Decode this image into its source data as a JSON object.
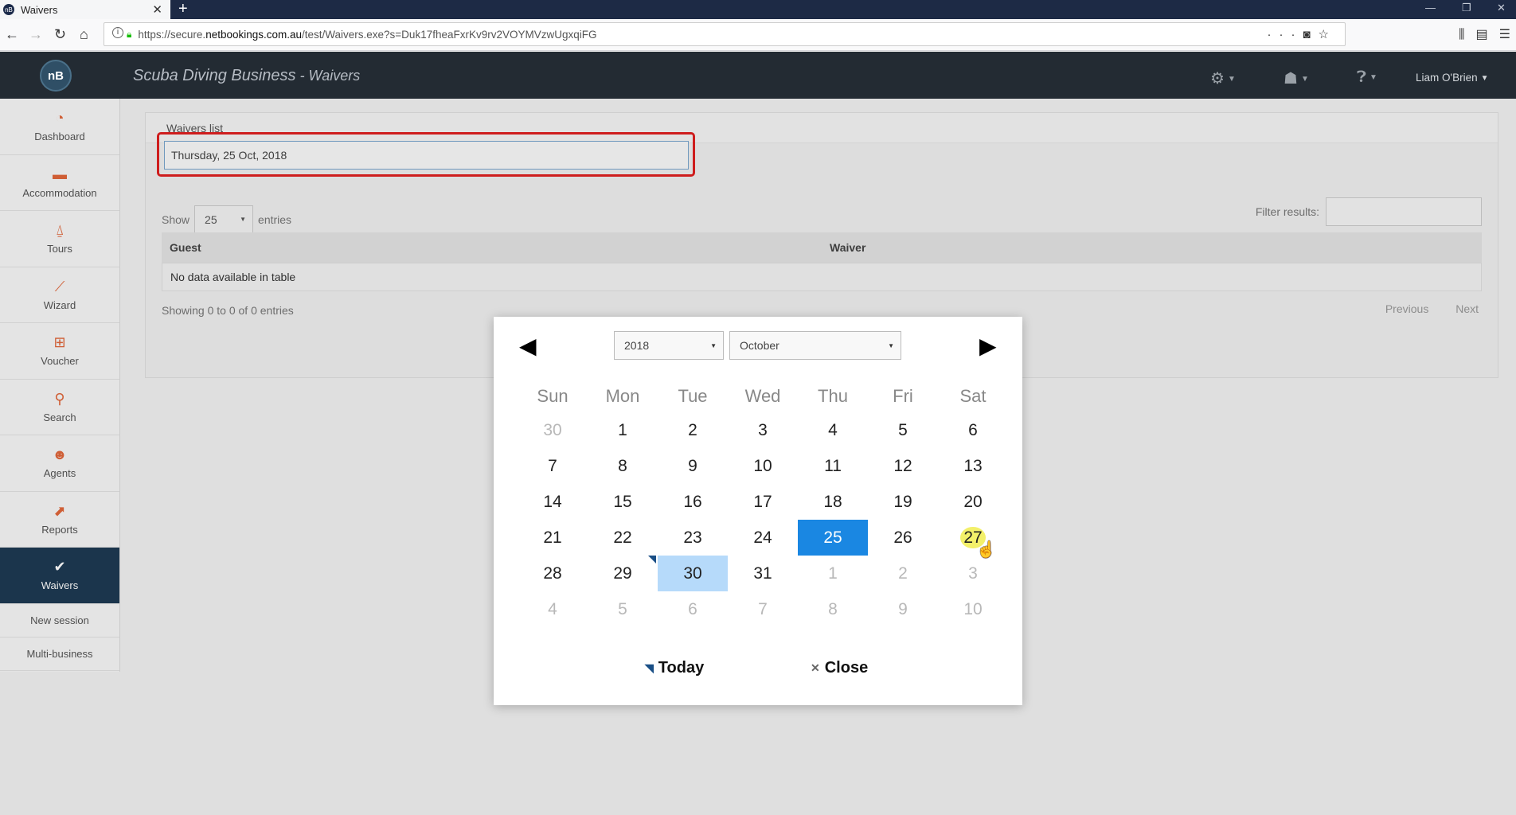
{
  "browser": {
    "tab_title": "Waivers",
    "favicon_text": "nB",
    "url_prefix": "https://secure.",
    "url_domain": "netbookings.com.au",
    "url_rest": "/test/Waivers.exe?s=Duk17fheaFxrKv9rv2VOYMVzwUgxqiFG"
  },
  "header": {
    "logo_text": "nB",
    "title": "Scuba Diving Business",
    "subtitle": " - Waivers",
    "user_name": "Liam O'Brien"
  },
  "sidebar": {
    "items": [
      {
        "label": "Dashboard",
        "icon": "dashboard-icon"
      },
      {
        "label": "Accommodation",
        "icon": "bed-icon"
      },
      {
        "label": "Tours",
        "icon": "hanger-icon"
      },
      {
        "label": "Wizard",
        "icon": "wand-icon"
      },
      {
        "label": "Voucher",
        "icon": "gift-icon"
      },
      {
        "label": "Search",
        "icon": "search-icon"
      },
      {
        "label": "Agents",
        "icon": "agent-icon"
      },
      {
        "label": "Reports",
        "icon": "chart-icon"
      },
      {
        "label": "Waivers",
        "icon": "check-icon"
      }
    ],
    "links": [
      "New session",
      "Multi-business"
    ]
  },
  "panel": {
    "title": "Waivers list",
    "date_value": "Thursday, 25 Oct, 2018",
    "show_label": "Show",
    "entries_value": "25",
    "entries_label": "entries",
    "filter_label": "Filter results:",
    "columns": [
      "Guest",
      "Waiver"
    ],
    "empty_text": "No data available in table",
    "showing_text": "Showing 0 to 0 of 0 entries",
    "prev_label": "Previous",
    "next_label": "Next"
  },
  "datepicker": {
    "year": "2018",
    "month": "October",
    "weekdays": [
      "Sun",
      "Mon",
      "Tue",
      "Wed",
      "Thu",
      "Fri",
      "Sat"
    ],
    "weeks": [
      [
        "30",
        "1",
        "2",
        "3",
        "4",
        "5",
        "6"
      ],
      [
        "7",
        "8",
        "9",
        "10",
        "11",
        "12",
        "13"
      ],
      [
        "14",
        "15",
        "16",
        "17",
        "18",
        "19",
        "20"
      ],
      [
        "21",
        "22",
        "23",
        "24",
        "25",
        "26",
        "27"
      ],
      [
        "28",
        "29",
        "30",
        "31",
        "1",
        "2",
        "3"
      ],
      [
        "4",
        "5",
        "6",
        "7",
        "8",
        "9",
        "10"
      ]
    ],
    "selected_day": "25",
    "today_day": "30",
    "today_label": "Today",
    "close_label": "Close"
  }
}
